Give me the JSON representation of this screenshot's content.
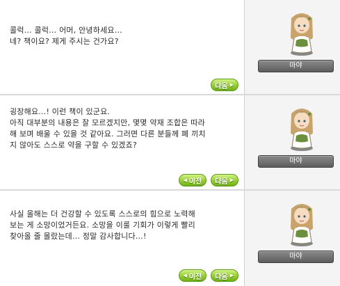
{
  "panels": [
    {
      "dialogue": "콜럭… 콜럭… 어머, 안녕하세요…\n네? 책이요? 제게 주시는 건가요?",
      "prev_label": "",
      "next_label": "다음",
      "npc_name": "마야"
    },
    {
      "dialogue": "굉장해요…! 이런 책이 있군요.\n아직 대부분의 내용은 잘 모르겠지만, 몇몇 약재 조합은 따라\n해 보며 배울 수 있을 것 같아요. 그러면 다른 분들께 폐 끼치\n지 않아도 스스로 약을 구할 수 있겠죠?",
      "prev_label": "이전",
      "next_label": "다음",
      "npc_name": "마야"
    },
    {
      "dialogue": "사실 올해는 더 건강할 수 있도록 스스로의 힘으로 노력해\n보는 게 소망이었거든요. 소망을 이룰 기회가 이렇게 빨리\n찾아올 줄 몰랐는데… 정말 감사합니다…!",
      "prev_label": "이전",
      "next_label": "다음",
      "npc_name": "마야"
    }
  ],
  "icons": {
    "prev": "left-arrow-icon",
    "next": "right-arrow-icon",
    "npc": "npc-portrait-maya"
  },
  "colors": {
    "button_green": "#8cc82a",
    "nameplate_gray": "#6e6e6e",
    "npc_hair": "#c9a36a",
    "npc_headscarf": "#b89a6a",
    "npc_dress": "#ffffff"
  }
}
